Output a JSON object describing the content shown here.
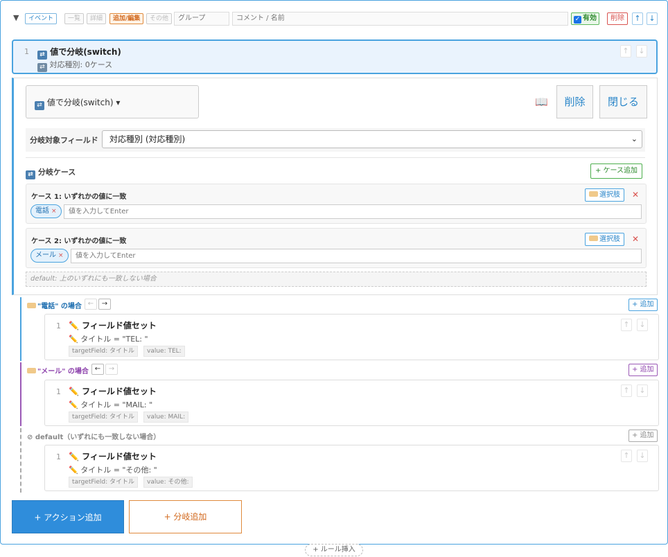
{
  "toolbar": {
    "tags": {
      "event": "イベント",
      "list": "一覧",
      "detail": "詳細",
      "add_edit": "追加/編集",
      "other": "その他"
    },
    "group_placeholder": "グループ",
    "comment_placeholder": "コメント / 名前",
    "enabled_label": "有効",
    "delete_label": "削除"
  },
  "block": {
    "number": "1",
    "title": "値で分岐(switch)",
    "subtitle": "対応種別: 0ケース"
  },
  "editor": {
    "type_label": "値で分岐(switch)",
    "delete_label": "削除",
    "close_label": "閉じる",
    "field_label": "分岐対象フィールド",
    "field_value": "対応種別 (対応種別)",
    "cases_title": "分岐ケース",
    "add_case_label": "+ ケース追加",
    "options_label": "選択肢",
    "input_placeholder": "値を入力してEnter",
    "cases": [
      {
        "header": "ケース 1: いずれかの値に一致",
        "chip": "電話"
      },
      {
        "header": "ケース 2: いずれかの値に一致",
        "chip": "メール"
      }
    ],
    "default_note": "default: 上のいずれにも一致しない場合"
  },
  "branches": [
    {
      "header": "\"電話\" の場合",
      "add_label": "+ 追加",
      "action": {
        "number": "1",
        "title": "フィールド値セット",
        "summary": "タイトル = \"TEL: \"",
        "target": "targetField: タイトル",
        "value": "value: TEL:"
      }
    },
    {
      "header": "\"メール\" の場合",
      "add_label": "+ 追加",
      "action": {
        "number": "1",
        "title": "フィールド値セット",
        "summary": "タイトル = \"MAIL: \"",
        "target": "targetField: タイトル",
        "value": "value: MAIL:"
      }
    },
    {
      "header": "⊘ default（いずれにも一致しない場合）",
      "add_label": "+ 追加",
      "action": {
        "number": "1",
        "title": "フィールド値セット",
        "summary": "タイトル = \"その他: \"",
        "target": "targetField: タイトル",
        "value": "value: その他:"
      }
    }
  ],
  "footer": {
    "add_action": "+ アクション追加",
    "add_branch": "+ 分岐追加",
    "insert_rule": "+ ルール挿入"
  }
}
